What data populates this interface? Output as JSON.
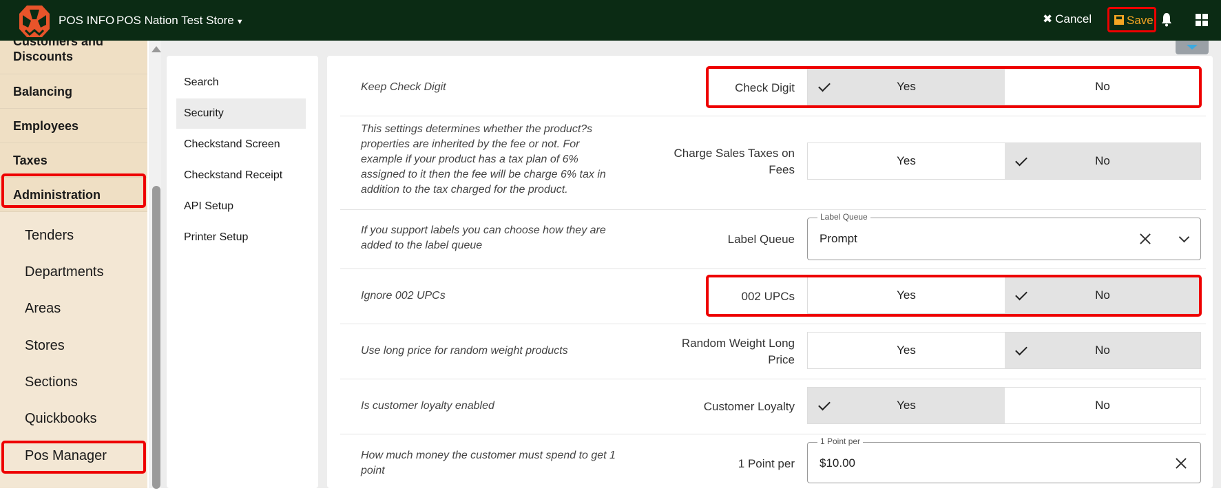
{
  "topbar": {
    "app_title": "POS INFO",
    "store_name": "POS Nation Test Store",
    "cancel_label": "Cancel",
    "save_label": "Save",
    "background": "#0b2b14",
    "accent": "#f5a623"
  },
  "sidebar": {
    "items": [
      {
        "label": "Customers and Discounts",
        "bold": true
      },
      {
        "label": "Balancing",
        "bold": true
      },
      {
        "label": "Employees",
        "bold": true
      },
      {
        "label": "Taxes",
        "bold": true
      },
      {
        "label": "Administration",
        "bold": true,
        "highlighted": true
      },
      {
        "label": "Tenders"
      },
      {
        "label": "Departments"
      },
      {
        "label": "Areas"
      },
      {
        "label": "Stores"
      },
      {
        "label": "Sections"
      },
      {
        "label": "Quickbooks"
      },
      {
        "label": "Pos Manager",
        "highlighted": true
      }
    ]
  },
  "submenu": {
    "items": [
      {
        "label": "Search"
      },
      {
        "label": "Security",
        "active": true
      },
      {
        "label": "Checkstand Screen"
      },
      {
        "label": "Checkstand Receipt"
      },
      {
        "label": "API Setup"
      },
      {
        "label": "Printer Setup"
      }
    ]
  },
  "settings": [
    {
      "description": "Keep Check Digit",
      "label": "Check Digit",
      "type": "toggle",
      "yes": "Yes",
      "no": "No",
      "selected": "Yes",
      "highlighted": true
    },
    {
      "description": "This settings determines whether the product?s properties are inherited by the fee or not. For example if your product has a tax plan of 6% assigned to it then the fee will be charge 6% tax in addition to the tax charged for the product.",
      "label": "Charge Sales Taxes on Fees",
      "type": "toggle",
      "yes": "Yes",
      "no": "No",
      "selected": "No"
    },
    {
      "description": "If you support labels you can choose how they are added to the label queue",
      "label": "Label Queue",
      "type": "select",
      "legend": "Label Queue",
      "value": "Prompt"
    },
    {
      "description": "Ignore 002 UPCs",
      "label": "002 UPCs",
      "type": "toggle",
      "yes": "Yes",
      "no": "No",
      "selected": "No",
      "highlighted": true
    },
    {
      "description": "Use long price for random weight products",
      "label": "Random Weight Long Price",
      "type": "toggle",
      "yes": "Yes",
      "no": "No",
      "selected": "No"
    },
    {
      "description": "Is customer loyalty enabled",
      "label": "Customer Loyalty",
      "type": "toggle",
      "yes": "Yes",
      "no": "No",
      "selected": "Yes"
    },
    {
      "description": "How much money the customer must spend to get 1 point",
      "label": "1 Point per",
      "type": "input",
      "legend": "1 Point per",
      "value": "$10.00"
    }
  ],
  "colors": {
    "sidebar_bg": "#f3e7d4",
    "highlight": "#ee0000",
    "toggle_on": "#e3e3e3"
  }
}
